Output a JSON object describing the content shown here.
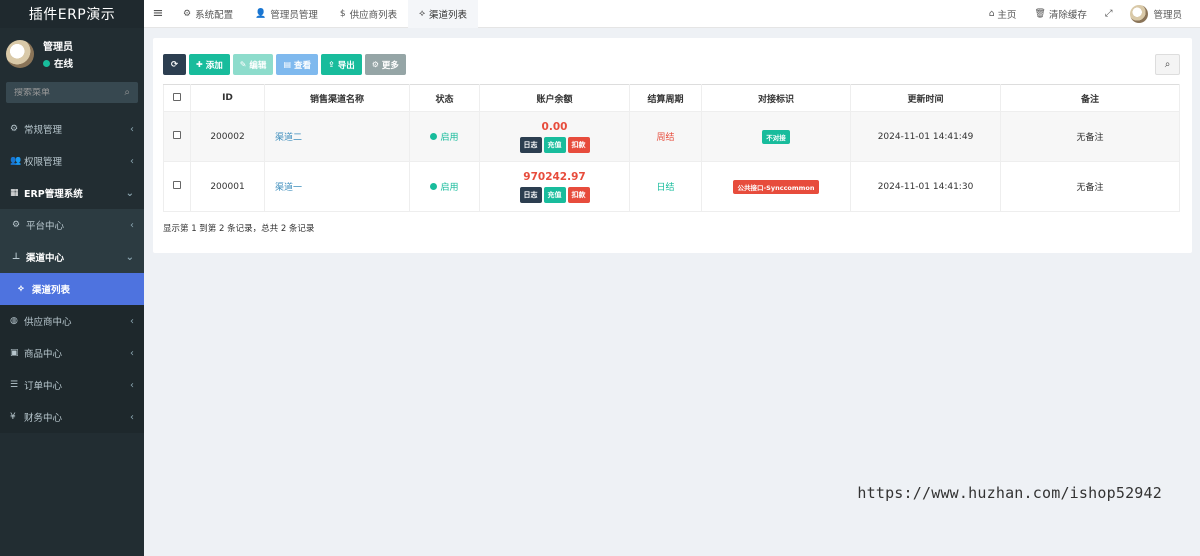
{
  "app": {
    "title": "插件ERP演示"
  },
  "user": {
    "name": "管理员",
    "status": "在线"
  },
  "sidebar": {
    "search_placeholder": "搜索菜单",
    "items": [
      {
        "label": "常规管理",
        "icon": "cogs-icon"
      },
      {
        "label": "权限管理",
        "icon": "group-icon"
      },
      {
        "label": "ERP管理系统",
        "icon": "table-icon"
      },
      {
        "label": "平台中心",
        "icon": "gear-icon"
      },
      {
        "label": "渠道中心",
        "icon": "sitemap-icon"
      },
      {
        "label": "渠道列表",
        "icon": "share-alt-icon"
      },
      {
        "label": "供应商中心",
        "icon": "globe-icon"
      },
      {
        "label": "商品中心",
        "icon": "briefcase-icon"
      },
      {
        "label": "订单中心",
        "icon": "list-icon"
      },
      {
        "label": "财务中心",
        "icon": "yen-icon"
      }
    ]
  },
  "topbar": {
    "tabs": [
      {
        "label": "系统配置",
        "icon": "gear-icon"
      },
      {
        "label": "管理员管理",
        "icon": "user-icon"
      },
      {
        "label": "供应商列表",
        "icon": "dollar-icon"
      },
      {
        "label": "渠道列表",
        "icon": "share-alt-icon"
      }
    ],
    "home": "主页",
    "clear_cache": "清除缓存",
    "user": "管理员"
  },
  "toolbar": {
    "add": "添加",
    "edit": "编辑",
    "view": "查看",
    "export": "导出",
    "more": "更多"
  },
  "table": {
    "headers": [
      "ID",
      "销售渠道名称",
      "状态",
      "账户余额",
      "结算周期",
      "对接标识",
      "更新时间",
      "备注"
    ],
    "action_labels": {
      "log": "日志",
      "charge": "充值",
      "deduct": "扣款"
    },
    "rows": [
      {
        "id": "200002",
        "name": "渠道二",
        "status": "启用",
        "balance": "0.00",
        "cycle": "周结",
        "tag": "不对接",
        "updated": "2024-11-01 14:41:49",
        "remark": "无备注"
      },
      {
        "id": "200001",
        "name": "渠道一",
        "status": "启用",
        "balance": "970242.97",
        "cycle": "日结",
        "tag": "公共接口-Synccommon",
        "updated": "2024-11-01 14:41:30",
        "remark": "无备注"
      }
    ]
  },
  "summary": "显示第 1 到第 2 条记录，总共 2 条记录",
  "watermark": "https://www.huzhan.com/ishop52942",
  "colors": {
    "sidebar": "#222d32",
    "active": "#4e73df",
    "success": "#18bc9c",
    "danger": "#e74c3c"
  }
}
